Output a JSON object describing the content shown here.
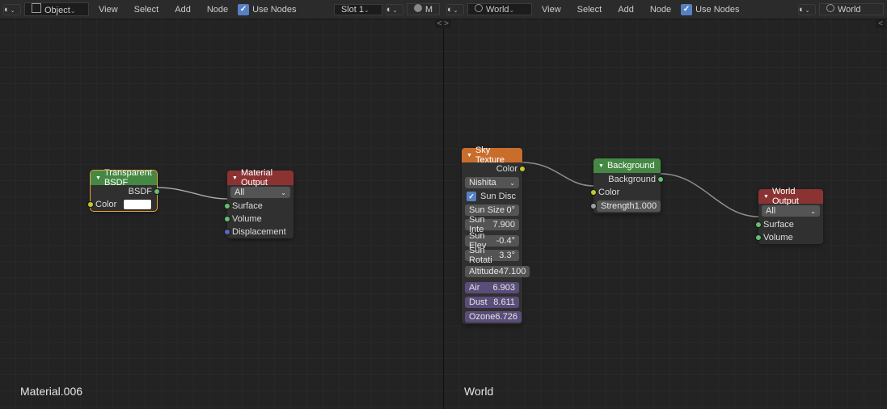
{
  "header_left": {
    "mode": "Object",
    "menus": [
      "View",
      "Select",
      "Add",
      "Node"
    ],
    "use_nodes": "Use Nodes",
    "slot": "Slot 1",
    "material_short": "M"
  },
  "header_right": {
    "mode": "World",
    "menus": [
      "View",
      "Select",
      "Add",
      "Node"
    ],
    "use_nodes": "Use Nodes",
    "world_field": "World"
  },
  "editor_left_label": "Material.006",
  "editor_right_label": "World",
  "node_transparent": {
    "title": "Transparent BSDF",
    "out_bsdf": "BSDF",
    "in_color": "Color",
    "color_value": "#ffffff"
  },
  "node_material_output": {
    "title": "Material Output",
    "target": "All",
    "in_surface": "Surface",
    "in_volume": "Volume",
    "in_displacement": "Displacement"
  },
  "node_sky": {
    "title": "Sky Texture",
    "out_color": "Color",
    "sky_type": "Nishita",
    "sun_disc_label": "Sun Disc",
    "rows": [
      {
        "label": "Sun Size",
        "value": "0°"
      },
      {
        "label": "Sun Inte",
        "value": "7.900"
      },
      {
        "label": "Sun Elev",
        "value": "-0.4°"
      },
      {
        "label": "Sun Rotati",
        "value": "3.3°"
      },
      {
        "label": "Altitude",
        "value": "47.100"
      },
      {
        "label": "Air",
        "value": "6.903",
        "driven": true
      },
      {
        "label": "Dust",
        "value": "8.611",
        "driven": true
      },
      {
        "label": "Ozone",
        "value": "6.726",
        "driven": true
      }
    ]
  },
  "node_background": {
    "title": "Background",
    "out_bg": "Background",
    "in_color": "Color",
    "strength_label": "Strength",
    "strength_value": "1.000"
  },
  "node_world_output": {
    "title": "World Output",
    "target": "All",
    "in_surface": "Surface",
    "in_volume": "Volume"
  }
}
